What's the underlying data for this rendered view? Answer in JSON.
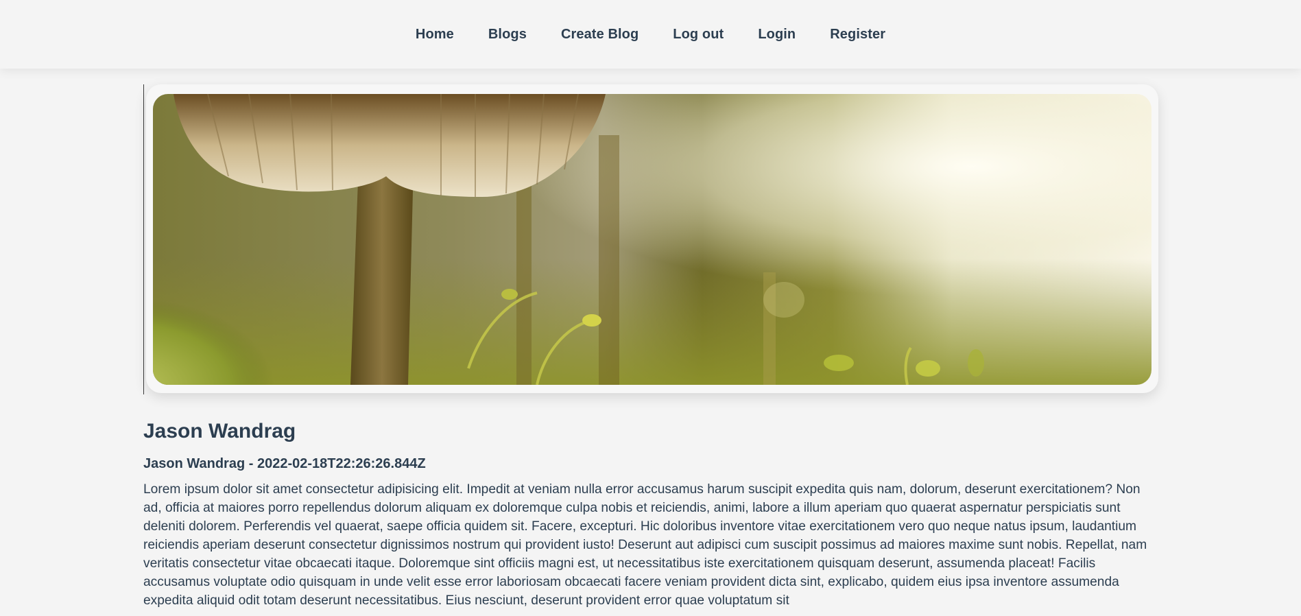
{
  "nav": {
    "items": [
      {
        "label": "Home"
      },
      {
        "label": "Blogs"
      },
      {
        "label": "Create Blog"
      },
      {
        "label": "Log out"
      },
      {
        "label": "Login"
      },
      {
        "label": "Register"
      }
    ]
  },
  "post": {
    "title": "Jason Wandrag",
    "meta": "Jason Wandrag - 2022-02-18T22:26:26.844Z",
    "body": "Lorem ipsum dolor sit amet consectetur adipisicing elit. Impedit at veniam nulla error accusamus harum suscipit expedita quis nam, dolorum, deserunt exercitationem? Non ad, officia at maiores porro repellendus dolorum aliquam ex doloremque culpa nobis et reiciendis, animi, labore a illum aperiam quo quaerat aspernatur perspiciatis sunt deleniti dolorem. Perferendis vel quaerat, saepe officia quidem sit. Facere, excepturi. Hic doloribus inventore vitae exercitationem vero quo neque natus ipsum, laudantium reiciendis aperiam deserunt consectetur dignissimos nostrum qui provident iusto! Deserunt aut adipisci cum suscipit possimus ad maiores maxime sunt nobis. Repellat, nam veritatis consectetur vitae obcaecati itaque. Doloremque sint officiis magni est, ut necessitatibus iste exercitationem quisquam deserunt, assumenda placeat! Facilis accusamus voluptate odio quisquam in unde velit esse error laboriosam obcaecati facere veniam provident dicta sint, explicabo, quidem eius ipsa inventore assumenda expedita aliquid odit totam deserunt necessitatibus. Eius nesciunt, deserunt provident error quae voluptatum sit"
  },
  "colors": {
    "background": "#f4f4f4",
    "text": "#2c3e50"
  },
  "hero": {
    "subject": "mushroom-moss-photo"
  }
}
